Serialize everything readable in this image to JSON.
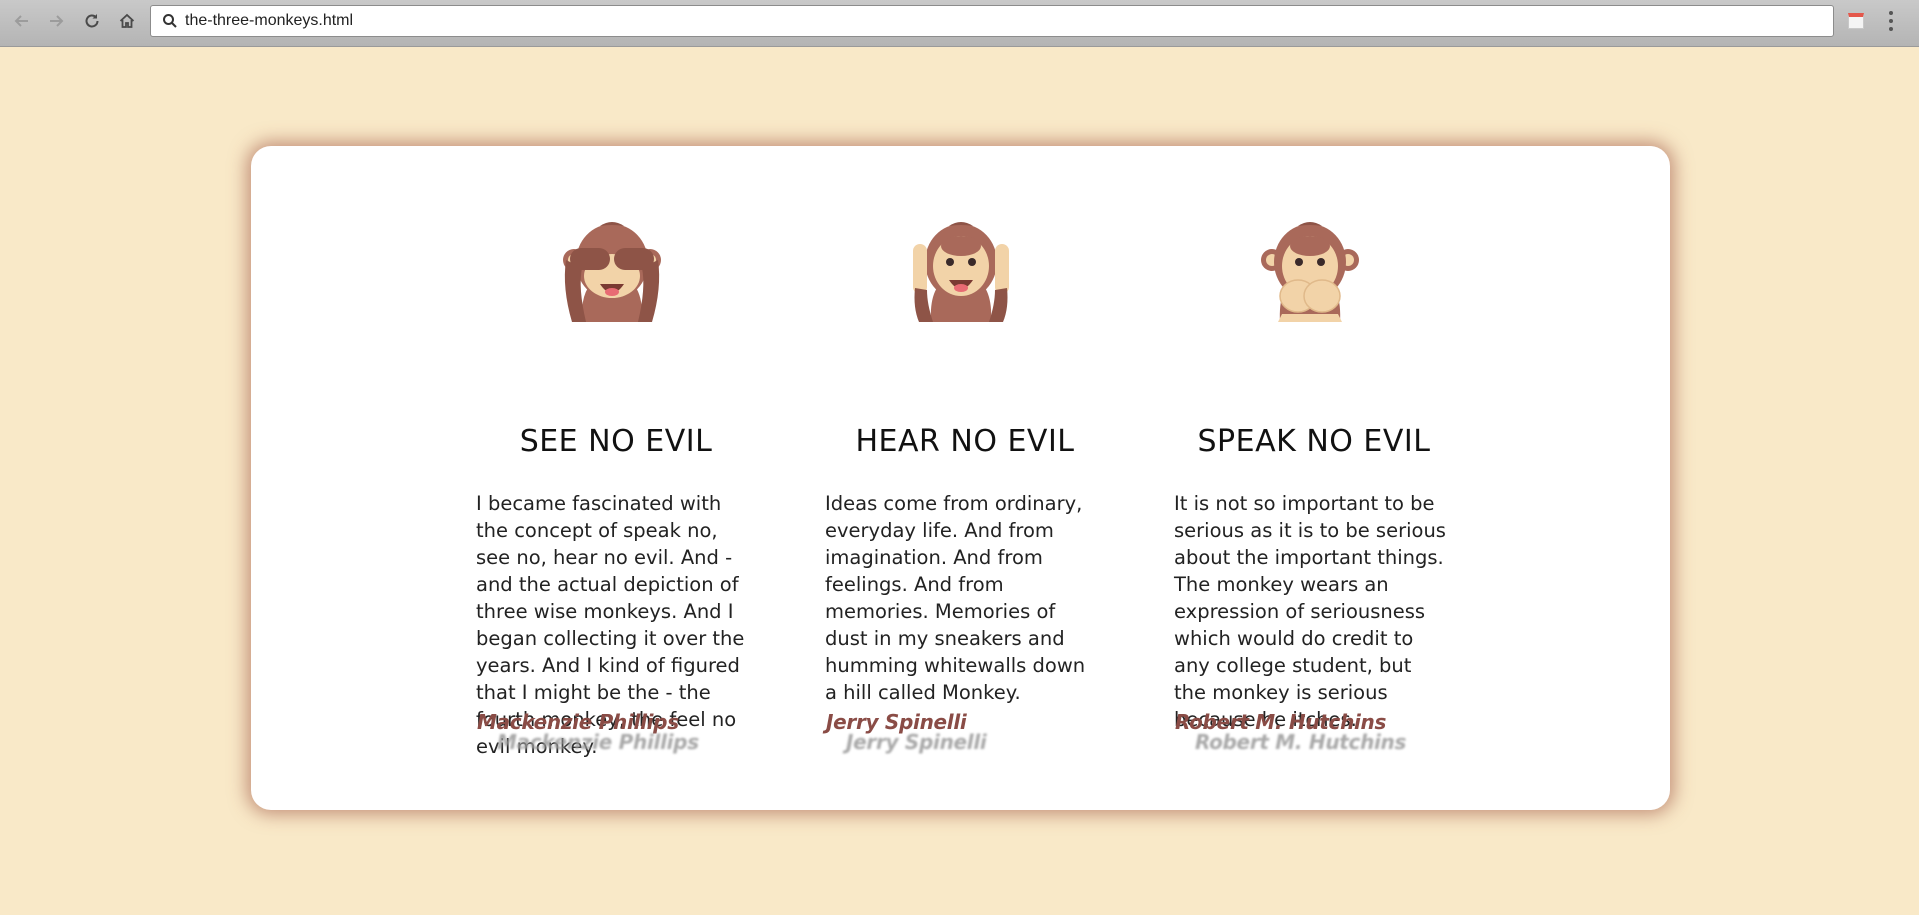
{
  "browser": {
    "url": "the-three-monkeys.html",
    "back_icon": "arrow-left-icon",
    "forward_icon": "arrow-right-icon",
    "reload_icon": "reload-icon",
    "home_icon": "home-icon",
    "search_icon": "search-icon",
    "extension_icon": "calendar-extension-icon",
    "menu_icon": "kebab-menu-icon"
  },
  "colors": {
    "page_background": "#f9e9c8",
    "card_background": "#ffffff",
    "card_shadow": "#a04a3a",
    "author": "#8a4c46",
    "monkey_fur": "#a9695a",
    "monkey_face": "#f2d3a8"
  },
  "monkeys": [
    {
      "icon": "see-no-evil-monkey-icon",
      "title": "SEE NO EVIL",
      "quote": "I became fascinated with the concept of speak no, see no, hear no evil. And - and the actual depiction of three wise monkeys. And I began collecting it over the years. And I kind of figured that I might be the - the fourth monkey, the feel no evil monkey.",
      "author": "Mackenzie Phillips"
    },
    {
      "icon": "hear-no-evil-monkey-icon",
      "title": "HEAR NO EVIL",
      "quote": "Ideas come from ordinary, everyday life. And from imagination. And from feelings. And from memories. Memories of dust in my sneakers and humming whitewalls down a hill called Monkey.",
      "author": "Jerry Spinelli"
    },
    {
      "icon": "speak-no-evil-monkey-icon",
      "title": "SPEAK NO EVIL",
      "quote": "It is not so important to be serious as it is to be serious about the important things. The monkey wears an expression of seriousness which would do credit to any college student, but the monkey is serious because he itches.",
      "author": "Robert M. Hutchins"
    }
  ]
}
